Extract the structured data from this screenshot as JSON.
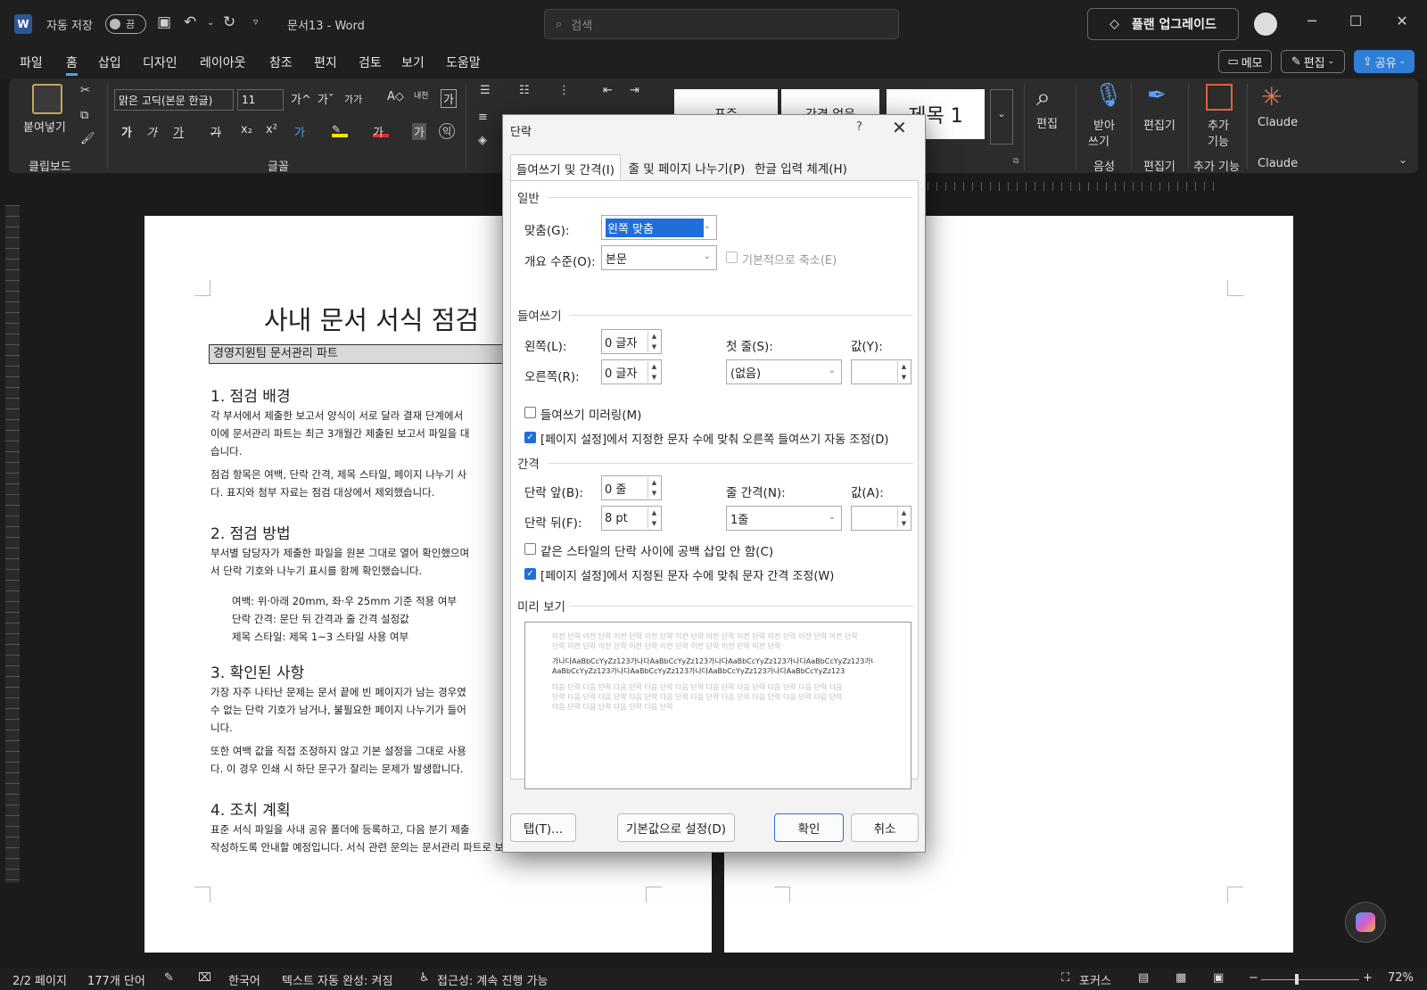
{
  "titlebar": {
    "autosave_label": "자동 저장",
    "autosave_state": "끔",
    "doc_title": "문서13",
    "separator": "-",
    "app_name": "Word",
    "search_placeholder": "검색",
    "upgrade_label": "플랜 업그레이드"
  },
  "menu": {
    "items": [
      "파일",
      "홈",
      "삽입",
      "디자인",
      "레이아웃",
      "참조",
      "편지",
      "검토",
      "보기",
      "도움말"
    ],
    "active": "홈",
    "memo": "메모",
    "edit": "편집",
    "share": "공유"
  },
  "ribbon": {
    "paste": "붙여넣기",
    "clipboard": "클립보드",
    "font_name": "맑은 고딕(본문 한글)",
    "font_size": "11",
    "font_group": "글꼴",
    "styles": [
      "표준",
      "간격 없음",
      "제목 1"
    ],
    "find": "편집",
    "dictate_1": "받아",
    "dictate_2": "쓰기",
    "voice_group": "음성",
    "editor": "편집기",
    "editor_group": "편집기",
    "addins_1": "추가",
    "addins_2": "기능",
    "addins_group": "추가 기능",
    "claude": "Claude",
    "claude_group": "Claude"
  },
  "document": {
    "title": "사내 문서 서식 점검",
    "subtitle": "경영지원팀 문서관리 파트",
    "sections": [
      {
        "heading": "1. 점검 배경",
        "paragraphs": [
          "각 부서에서 제출한 보고서 양식이 서로 달라 결재 단계에서",
          "이에 문서관리 파트는 최근 3개월간 제출된 보고서 파일을 대",
          "습니다.",
          "점검 항목은 여백, 단락 간격, 제목 스타일, 페이지 나누기 사",
          "다. 표지와 첨부 자료는 점검 대상에서 제외했습니다."
        ]
      },
      {
        "heading": "2. 점검 방법",
        "paragraphs": [
          "부서별 담당자가 제출한 파일을 원본 그대로 열어 확인했으며",
          "서 단락 기호와 나누기 표시를 함께 확인했습니다."
        ],
        "list": [
          "여백: 위·아래 20mm, 좌·우 25mm 기준 적용 여부",
          "단락 간격: 문단 뒤 간격과 줄 간격 설정값",
          "제목 스타일: 제목 1~3 스타일 사용 여부"
        ]
      },
      {
        "heading": "3. 확인된 사항",
        "paragraphs": [
          "가장 자주 나타난 문제는 문서 끝에 빈 페이지가 남는 경우였",
          "수 없는 단락 기호가 남거나, 불필요한 페이지 나누기가 들어",
          "니다.",
          "또한 여백 값을 직접 조정하지 않고 기본 설정을 그대로 사용",
          "다. 이 경우 인쇄 시 하단 문구가 잘리는 문제가 발생합니다."
        ]
      },
      {
        "heading": "4. 조치 계획",
        "paragraphs": [
          "표준 서식 파일을 사내 공유 폴더에 등록하고, 다음 분기 제출",
          "작성하도록 안내할 예정입니다. 서식 관련 문의는 문서관리 파트로 보내주십시오."
        ]
      }
    ]
  },
  "dialog": {
    "title": "단락",
    "help": "?",
    "tabs": [
      "들여쓰기 및 간격(I)",
      "줄 및 페이지 나누기(P)",
      "한글 입력 체계(H)"
    ],
    "general": {
      "section": "일반",
      "alignment_label": "맞춤(G):",
      "alignment_value": "왼쪽 맞춤",
      "outline_label": "개요 수준(O):",
      "outline_value": "본문",
      "collapse_label": "기본적으로 축소(E)"
    },
    "indent": {
      "section": "들여쓰기",
      "left_label": "왼쪽(L):",
      "left_value": "0 글자",
      "right_label": "오른쪽(R):",
      "right_value": "0 글자",
      "special_label": "첫 줄(S):",
      "special_value": "(없음)",
      "by_label": "값(Y):",
      "by_value": "",
      "mirror_label": "들여쓰기 미러링(M)",
      "auto_adjust_label": "[페이지 설정]에서 지정한 문자 수에 맞춰 오른쪽 들여쓰기 자동 조정(D)"
    },
    "spacing": {
      "section": "간격",
      "before_label": "단락 앞(B):",
      "before_value": "0 줄",
      "after_label": "단락 뒤(F):",
      "after_value": "8 pt",
      "line_label": "줄 간격(N):",
      "line_value": "1줄",
      "at_label": "값(A):",
      "at_value": "",
      "no_space_label": "같은 스타일의 단락 사이에 공백 삽입 안 함(C)",
      "grid_label": "[페이지 설정]에서 지정된 문자 수에 맞춰 문자 간격 조정(W)"
    },
    "preview": {
      "section": "미리 보기",
      "prev_1": "이전 단락 이전 단락 이전 단락 이전 단락 이전 단락 이전 단락 이전 단락 이전 단락 이전 단락 이전 단락",
      "prev_2": "단락 이전 단락 이전 단락 이전 단락 이전 단락 이전 단락 이전 단락 이전 단락",
      "sample_1": "가나다AaBbCcYyZz123가나다AaBbCcYyZz123가나다AaBbCcYyZz123가나다AaBbCcYyZz123가나다",
      "sample_2": "AaBbCcYyZz123가나다AaBbCcYyZz123가나다AaBbCcYyZz123가나다AaBbCcYyZz123",
      "next_1": "다음 단락 다음 단락 다음 단락 다음 단락 다음 단락 다음 단락 다음 단락 다음 단락 다음 단락 다음",
      "next_2": "단락 다음 단락 다음 단락 다음 단락 다음 단락 다음 단락 다음 단락 다음 단락 다음 단락 다음 단락",
      "next_3": "다음 단락 다음 단락 다음 단락 다음 단락"
    },
    "buttons": {
      "tabs": "탭(T)...",
      "default": "기본값으로 설정(D)",
      "ok": "확인",
      "cancel": "취소"
    }
  },
  "statusbar": {
    "page": "2/2 페이지",
    "words": "177개 단어",
    "language": "한국어",
    "autocomplete": "텍스트 자동 완성: 켜짐",
    "accessibility": "접근성: 계속 진행 가능",
    "focus": "포커스",
    "zoom": "72%"
  },
  "colors": {
    "accent": "#2f7fd8",
    "selection": "#1e6fd9",
    "word_blue": "#2b5797"
  }
}
